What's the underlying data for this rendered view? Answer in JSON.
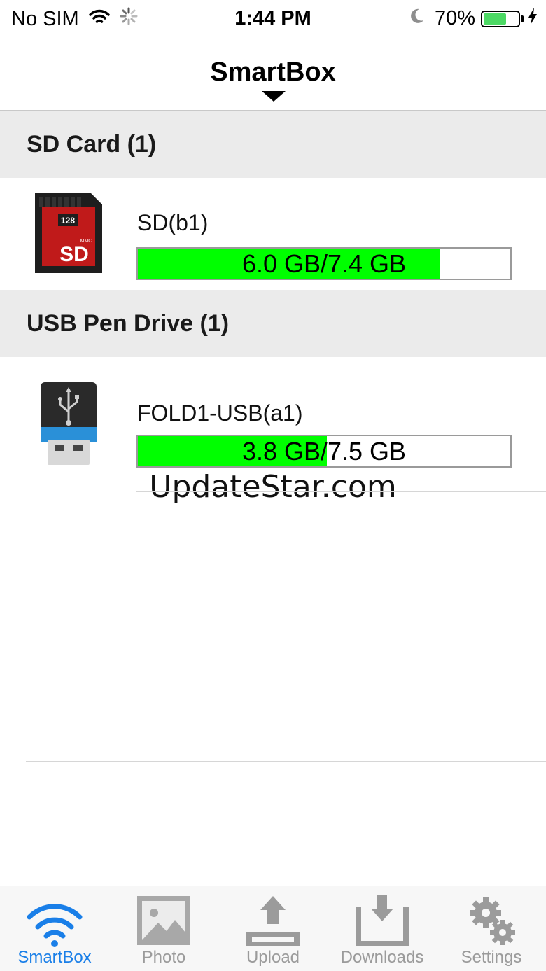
{
  "status_bar": {
    "carrier": "No SIM",
    "time": "1:44 PM",
    "battery_percent": "70%",
    "battery_level": 0.7,
    "battery_color": "#4cd964"
  },
  "nav": {
    "title": "SmartBox"
  },
  "sections": [
    {
      "title": "SD Card (1)",
      "devices": [
        {
          "name": "SD(b1)",
          "usage_text": "6.0 GB/7.4 GB",
          "used_gb": 6.0,
          "total_gb": 7.4,
          "icon": "sd-card-icon",
          "icon_label_capacity": "128",
          "icon_label_type": "SD",
          "icon_label_mmc": "MMC"
        }
      ]
    },
    {
      "title": "USB Pen Drive (1)",
      "devices": [
        {
          "name": "FOLD1-USB(a1)",
          "usage_text": "3.8 GB/7.5 GB",
          "used_gb": 3.8,
          "total_gb": 7.5,
          "icon": "usb-drive-icon"
        }
      ]
    }
  ],
  "watermark": "UpdateStar.com",
  "tabs": [
    {
      "label": "SmartBox",
      "icon": "wifi-icon",
      "active": true
    },
    {
      "label": "Photo",
      "icon": "photo-icon",
      "active": false
    },
    {
      "label": "Upload",
      "icon": "upload-icon",
      "active": false
    },
    {
      "label": "Downloads",
      "icon": "downloads-icon",
      "active": false
    },
    {
      "label": "Settings",
      "icon": "gear-icon",
      "active": false
    }
  ],
  "colors": {
    "accent": "#1a7fe8",
    "usage_fill": "#00ff00",
    "inactive_tab": "#9b9b9b",
    "section_bg": "#ebebeb"
  }
}
